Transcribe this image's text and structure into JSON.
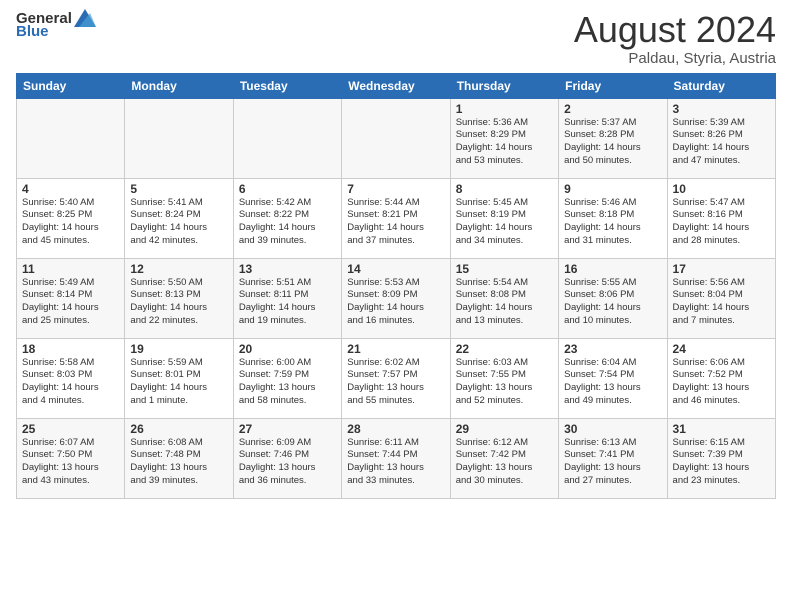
{
  "header": {
    "logo_general": "General",
    "logo_blue": "Blue",
    "month": "August 2024",
    "location": "Paldau, Styria, Austria"
  },
  "days_of_week": [
    "Sunday",
    "Monday",
    "Tuesday",
    "Wednesday",
    "Thursday",
    "Friday",
    "Saturday"
  ],
  "weeks": [
    [
      {
        "day": "",
        "info": ""
      },
      {
        "day": "",
        "info": ""
      },
      {
        "day": "",
        "info": ""
      },
      {
        "day": "",
        "info": ""
      },
      {
        "day": "1",
        "info": "Sunrise: 5:36 AM\nSunset: 8:29 PM\nDaylight: 14 hours\nand 53 minutes."
      },
      {
        "day": "2",
        "info": "Sunrise: 5:37 AM\nSunset: 8:28 PM\nDaylight: 14 hours\nand 50 minutes."
      },
      {
        "day": "3",
        "info": "Sunrise: 5:39 AM\nSunset: 8:26 PM\nDaylight: 14 hours\nand 47 minutes."
      }
    ],
    [
      {
        "day": "4",
        "info": "Sunrise: 5:40 AM\nSunset: 8:25 PM\nDaylight: 14 hours\nand 45 minutes."
      },
      {
        "day": "5",
        "info": "Sunrise: 5:41 AM\nSunset: 8:24 PM\nDaylight: 14 hours\nand 42 minutes."
      },
      {
        "day": "6",
        "info": "Sunrise: 5:42 AM\nSunset: 8:22 PM\nDaylight: 14 hours\nand 39 minutes."
      },
      {
        "day": "7",
        "info": "Sunrise: 5:44 AM\nSunset: 8:21 PM\nDaylight: 14 hours\nand 37 minutes."
      },
      {
        "day": "8",
        "info": "Sunrise: 5:45 AM\nSunset: 8:19 PM\nDaylight: 14 hours\nand 34 minutes."
      },
      {
        "day": "9",
        "info": "Sunrise: 5:46 AM\nSunset: 8:18 PM\nDaylight: 14 hours\nand 31 minutes."
      },
      {
        "day": "10",
        "info": "Sunrise: 5:47 AM\nSunset: 8:16 PM\nDaylight: 14 hours\nand 28 minutes."
      }
    ],
    [
      {
        "day": "11",
        "info": "Sunrise: 5:49 AM\nSunset: 8:14 PM\nDaylight: 14 hours\nand 25 minutes."
      },
      {
        "day": "12",
        "info": "Sunrise: 5:50 AM\nSunset: 8:13 PM\nDaylight: 14 hours\nand 22 minutes."
      },
      {
        "day": "13",
        "info": "Sunrise: 5:51 AM\nSunset: 8:11 PM\nDaylight: 14 hours\nand 19 minutes."
      },
      {
        "day": "14",
        "info": "Sunrise: 5:53 AM\nSunset: 8:09 PM\nDaylight: 14 hours\nand 16 minutes."
      },
      {
        "day": "15",
        "info": "Sunrise: 5:54 AM\nSunset: 8:08 PM\nDaylight: 14 hours\nand 13 minutes."
      },
      {
        "day": "16",
        "info": "Sunrise: 5:55 AM\nSunset: 8:06 PM\nDaylight: 14 hours\nand 10 minutes."
      },
      {
        "day": "17",
        "info": "Sunrise: 5:56 AM\nSunset: 8:04 PM\nDaylight: 14 hours\nand 7 minutes."
      }
    ],
    [
      {
        "day": "18",
        "info": "Sunrise: 5:58 AM\nSunset: 8:03 PM\nDaylight: 14 hours\nand 4 minutes."
      },
      {
        "day": "19",
        "info": "Sunrise: 5:59 AM\nSunset: 8:01 PM\nDaylight: 14 hours\nand 1 minute."
      },
      {
        "day": "20",
        "info": "Sunrise: 6:00 AM\nSunset: 7:59 PM\nDaylight: 13 hours\nand 58 minutes."
      },
      {
        "day": "21",
        "info": "Sunrise: 6:02 AM\nSunset: 7:57 PM\nDaylight: 13 hours\nand 55 minutes."
      },
      {
        "day": "22",
        "info": "Sunrise: 6:03 AM\nSunset: 7:55 PM\nDaylight: 13 hours\nand 52 minutes."
      },
      {
        "day": "23",
        "info": "Sunrise: 6:04 AM\nSunset: 7:54 PM\nDaylight: 13 hours\nand 49 minutes."
      },
      {
        "day": "24",
        "info": "Sunrise: 6:06 AM\nSunset: 7:52 PM\nDaylight: 13 hours\nand 46 minutes."
      }
    ],
    [
      {
        "day": "25",
        "info": "Sunrise: 6:07 AM\nSunset: 7:50 PM\nDaylight: 13 hours\nand 43 minutes."
      },
      {
        "day": "26",
        "info": "Sunrise: 6:08 AM\nSunset: 7:48 PM\nDaylight: 13 hours\nand 39 minutes."
      },
      {
        "day": "27",
        "info": "Sunrise: 6:09 AM\nSunset: 7:46 PM\nDaylight: 13 hours\nand 36 minutes."
      },
      {
        "day": "28",
        "info": "Sunrise: 6:11 AM\nSunset: 7:44 PM\nDaylight: 13 hours\nand 33 minutes."
      },
      {
        "day": "29",
        "info": "Sunrise: 6:12 AM\nSunset: 7:42 PM\nDaylight: 13 hours\nand 30 minutes."
      },
      {
        "day": "30",
        "info": "Sunrise: 6:13 AM\nSunset: 7:41 PM\nDaylight: 13 hours\nand 27 minutes."
      },
      {
        "day": "31",
        "info": "Sunrise: 6:15 AM\nSunset: 7:39 PM\nDaylight: 13 hours\nand 23 minutes."
      }
    ]
  ]
}
